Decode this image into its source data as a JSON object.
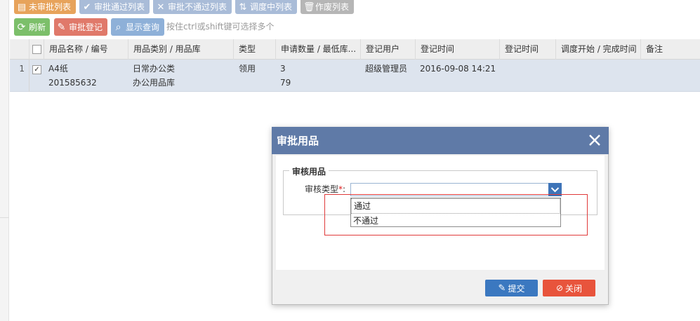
{
  "tabs": [
    {
      "label": "未审批列表",
      "icon": "list-icon"
    },
    {
      "label": "审批通过列表",
      "icon": "check-icon"
    },
    {
      "label": "审批不通过列表",
      "icon": "x-icon"
    },
    {
      "label": "调度中列表",
      "icon": "sort-icon"
    },
    {
      "label": "作废列表",
      "icon": "trash-icon"
    }
  ],
  "toolbar": {
    "refresh_label": "刷新",
    "approve_label": "审批登记",
    "search_label": "显示查询",
    "hint": "按住ctrl或shift键可选择多个"
  },
  "grid": {
    "columns": [
      "用品名称 / 编号",
      "用品类别 / 用品库",
      "类型",
      "申请数量 / 最低库...",
      "登记用户",
      "登记时间",
      "登记时间",
      "调度开始 / 完成时间",
      "备注"
    ],
    "rows": [
      {
        "index": "1",
        "checked": true,
        "name": "A4纸",
        "code": "201585632",
        "category": "日常办公类",
        "warehouse": "办公用品库",
        "type": "领用",
        "quantity": "3",
        "min_stock": "79",
        "user": "超级管理员",
        "time": "2016-09-08 14:21"
      }
    ]
  },
  "modal": {
    "title": "审批用品",
    "legend": "审核用品",
    "field_label": "审核类型",
    "required_mark": "*",
    "colon": ":",
    "options": [
      "通过",
      "不通过"
    ],
    "submit_label": "提交",
    "close_label": "关闭"
  },
  "colors": {
    "header_blue": "#5f7aa7",
    "submit_blue": "#3b78c0",
    "close_red": "#e8543c",
    "highlight_red": "#e03a3a"
  }
}
